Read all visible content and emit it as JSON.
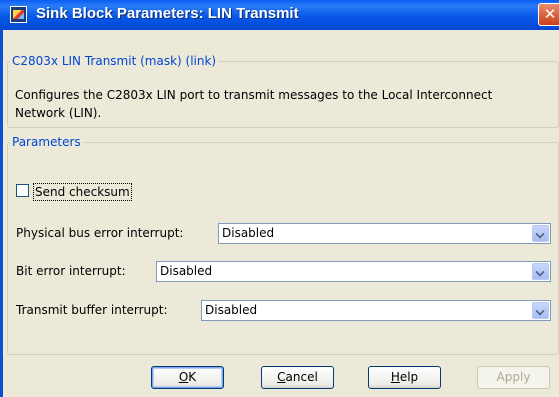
{
  "window": {
    "title": "Sink Block Parameters: LIN Transmit",
    "close_glyph": "✕"
  },
  "mask": {
    "legend": "C2803x LIN Transmit (mask) (link)",
    "description": "Configures the C2803x LIN port to transmit messages to the Local Interconnect Network (LIN)."
  },
  "parameters": {
    "legend": "Parameters",
    "send_checksum": {
      "label": "Send checksum",
      "checked": false
    },
    "physical_bus_error": {
      "label": "Physical bus error interrupt:",
      "value": "Disabled"
    },
    "bit_error": {
      "label": "Bit error interrupt:",
      "value": "Disabled"
    },
    "transmit_buffer": {
      "label": "Transmit buffer interrupt:",
      "value": "Disabled"
    }
  },
  "buttons": {
    "ok": {
      "mnemonic": "O",
      "rest": "K"
    },
    "cancel": {
      "mnemonic": "C",
      "rest": "ancel"
    },
    "help": {
      "mnemonic": "H",
      "rest": "elp"
    },
    "apply": {
      "label": "Apply",
      "enabled": false
    }
  },
  "colors": {
    "titlebar": "#0858e8",
    "group_legend": "#0046d5",
    "dialog_bg": "#ece9d8"
  },
  "icons": {
    "window_icon": "simulink-block-icon",
    "close_icon": "close-icon",
    "dropdown_icon": "chevron-down-icon"
  }
}
